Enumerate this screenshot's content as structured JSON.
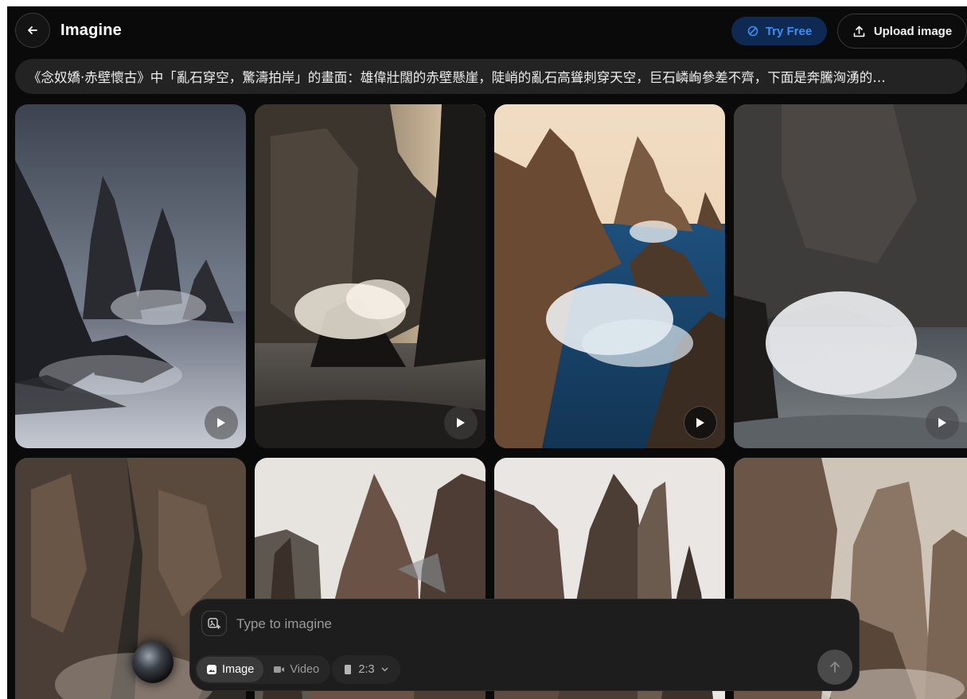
{
  "header": {
    "back_icon": "arrow-left-icon",
    "title": "Imagine",
    "try_free_label": "Try Free",
    "try_free_icon": "spark-circle-icon",
    "upload_label": "Upload image",
    "upload_icon": "upload-icon",
    "accent_color": "#3d8ef7"
  },
  "prompt": {
    "text": "《念奴嬌·赤壁懷古》中「亂石穿空，驚濤拍岸」的畫面：雄偉壯闊的赤壁懸崖，陡峭的亂石高聳刺穿天空，巨石嶙峋參差不齊，下面是奔騰洶湧的…"
  },
  "gallery": {
    "row1": [
      {
        "name": "stormy-sea-stacks",
        "has_video": true
      },
      {
        "name": "backlit-cliff-wave",
        "has_video": true
      },
      {
        "name": "sunlit-spires-blue-surf",
        "has_video": true
      },
      {
        "name": "dark-cliff-spray",
        "has_video": true
      }
    ],
    "row2": [
      {
        "name": "forested-cliff-mist"
      },
      {
        "name": "rocky-spires-pale-sky"
      },
      {
        "name": "twin-peaks-haze"
      },
      {
        "name": "sandstone-tower"
      }
    ],
    "play_icon": "play-icon"
  },
  "composer": {
    "placeholder": "Type to imagine",
    "add_image_icon": "image-add-icon",
    "modes": [
      {
        "label": "Image",
        "icon": "image-icon",
        "active": true
      },
      {
        "label": "Video",
        "icon": "video-camera-icon",
        "active": false
      }
    ],
    "aspect_ratio": "2:3",
    "aspect_icon": "portrait-rect-icon",
    "dropdown_icon": "chevron-down-icon",
    "send_icon": "arrow-up-icon"
  }
}
